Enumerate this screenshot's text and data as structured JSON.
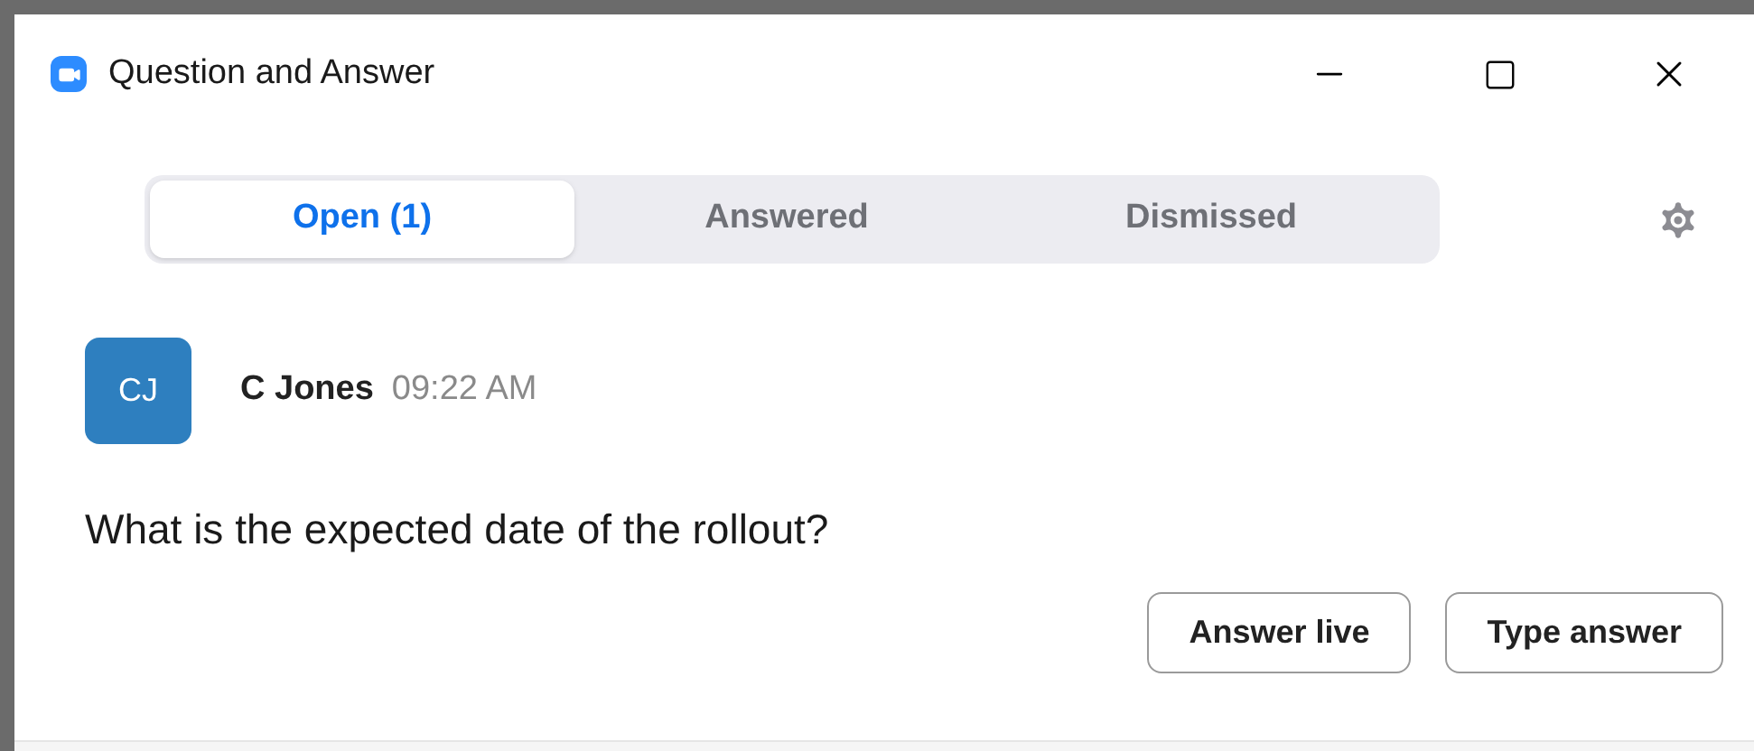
{
  "window": {
    "title": "Question and Answer"
  },
  "tabs": [
    {
      "label": "Open (1)",
      "selected": true
    },
    {
      "label": "Answered",
      "selected": false
    },
    {
      "label": "Dismissed",
      "selected": false
    }
  ],
  "question": {
    "avatar": "CJ",
    "author": "C Jones",
    "time": "09:22 AM",
    "text": "What is the expected date of the rollout?"
  },
  "buttons": [
    "Answer live",
    "Type answer"
  ]
}
